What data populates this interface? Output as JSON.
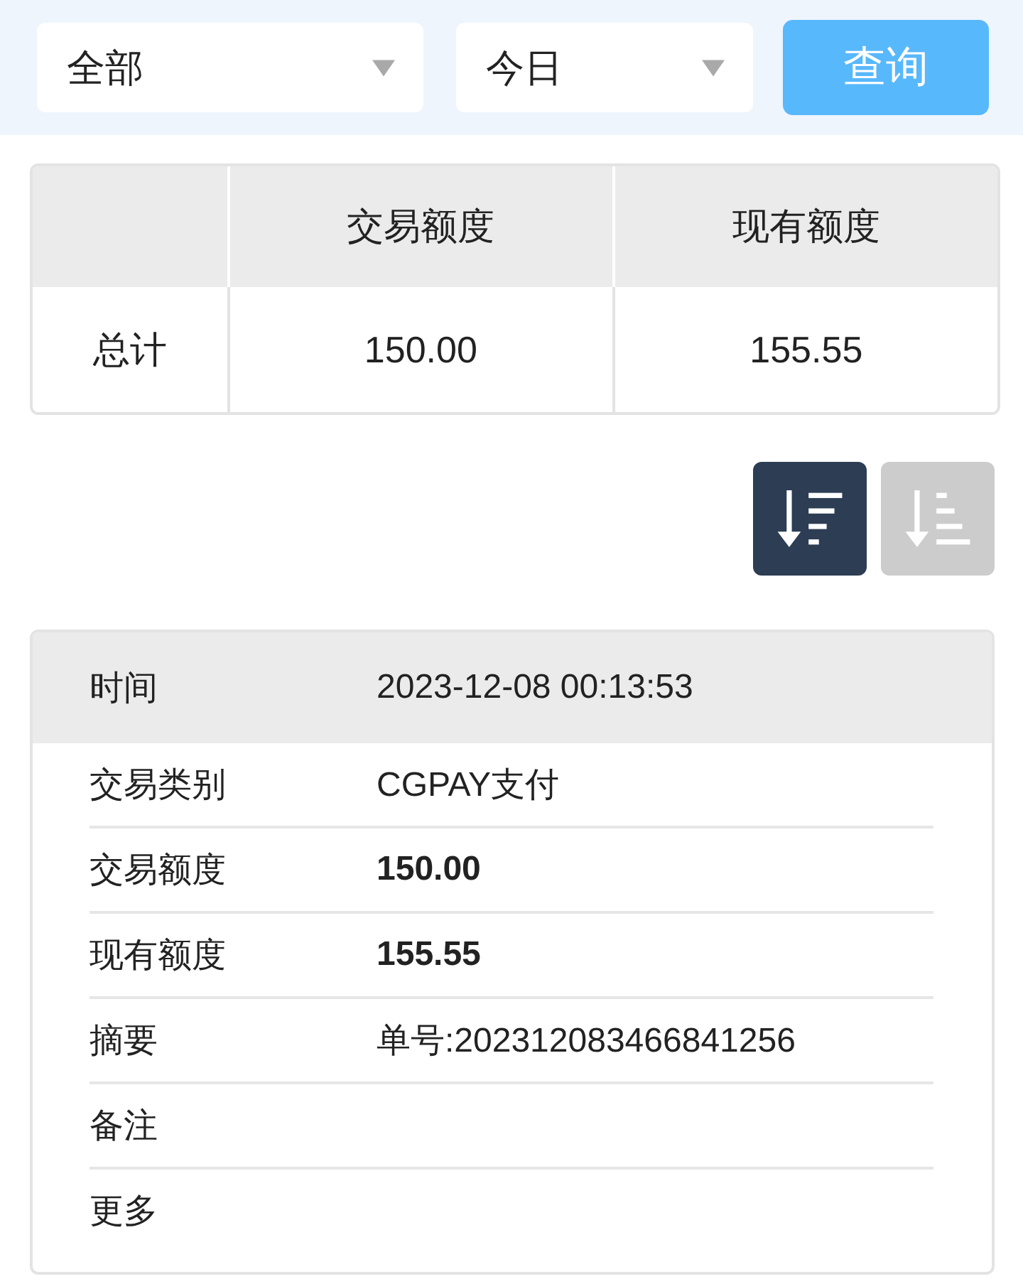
{
  "filters": {
    "category": {
      "value": "全部"
    },
    "period": {
      "value": "今日"
    },
    "query_button": "查询"
  },
  "summary_table": {
    "columns": [
      "交易额度",
      "现有额度"
    ],
    "rows": [
      {
        "label": "总计",
        "values": [
          "150.00",
          "155.55"
        ]
      }
    ]
  },
  "sort_buttons": [
    {
      "kind": "descending",
      "selected": true
    },
    {
      "kind": "ascending",
      "selected": false
    }
  ],
  "records": [
    {
      "header": {
        "label": "时间",
        "value": "2023-12-08 00:13:53"
      },
      "rows": [
        {
          "label": "交易类别",
          "value": "CGPAY支付",
          "bold": false
        },
        {
          "label": "交易额度",
          "value": "150.00",
          "bold": true
        },
        {
          "label": "现有额度",
          "value": "155.55",
          "bold": true
        },
        {
          "label": "摘要",
          "value": "单号:202312083466841256",
          "bold": false
        },
        {
          "label": "备注"
        },
        {
          "label": "更多"
        }
      ]
    }
  ]
}
